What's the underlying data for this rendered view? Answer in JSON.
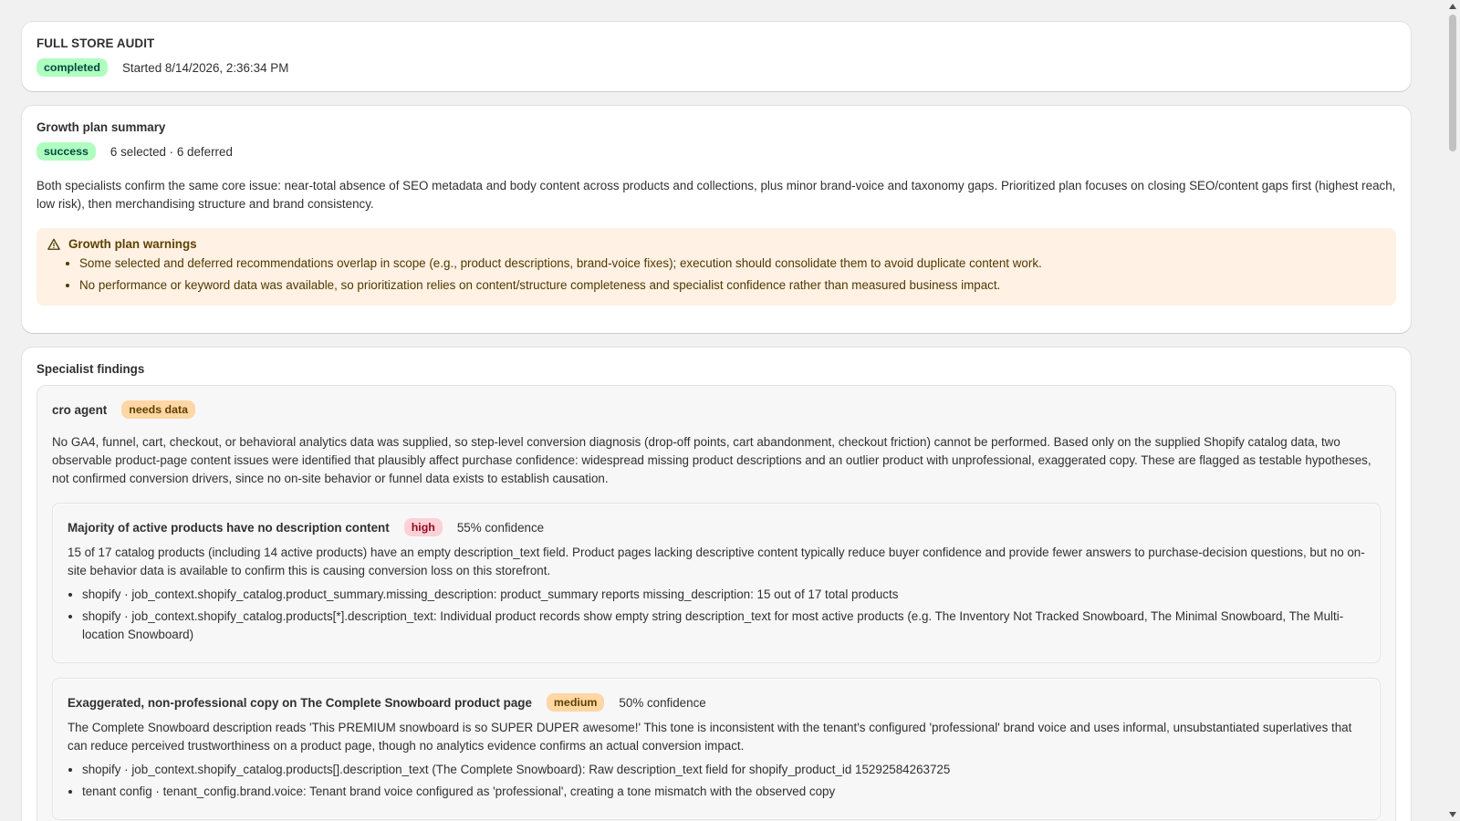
{
  "audit": {
    "title": "FULL STORE AUDIT",
    "status": "completed",
    "started": "Started 8/14/2026, 2:36:34 PM"
  },
  "growth_plan": {
    "title": "Growth plan summary",
    "status": "success",
    "counts": "6 selected · 6 deferred",
    "summary": "Both specialists confirm the same core issue: near-total absence of SEO metadata and body content across products and collections, plus minor brand-voice and taxonomy gaps. Prioritized plan focuses on closing SEO/content gaps first (highest reach, low risk), then merchandising structure and brand consistency.",
    "warnings_title": "Growth plan warnings",
    "warnings": [
      "Some selected and deferred recommendations overlap in scope (e.g., product descriptions, brand-voice fixes); execution should consolidate them to avoid duplicate content work.",
      "No performance or keyword data was available, so prioritization relies on content/structure completeness and specialist confidence rather than measured business impact."
    ]
  },
  "specialists": {
    "title": "Specialist findings",
    "agent": {
      "name": "cro agent",
      "status": "needs data",
      "description": "No GA4, funnel, cart, checkout, or behavioral analytics data was supplied, so step-level conversion diagnosis (drop-off points, cart abandonment, checkout friction) cannot be performed. Based only on the supplied Shopify catalog data, two observable product-page content issues were identified that plausibly affect purchase confidence: widespread missing product descriptions and an outlier product with unprofessional, exaggerated copy. These are flagged as testable hypotheses, not confirmed conversion drivers, since no on-site behavior or funnel data exists to establish causation.",
      "findings": [
        {
          "title": "Majority of active products have no description content",
          "severity": "high",
          "confidence": "55% confidence",
          "body": "15 of 17 catalog products (including 14 active products) have an empty description_text field. Product pages lacking descriptive content typically reduce buyer confidence and provide fewer answers to purchase-decision questions, but no on-site behavior data is available to confirm this is causing conversion loss on this storefront.",
          "evidence": [
            "shopify · job_context.shopify_catalog.product_summary.missing_description: product_summary reports missing_description: 15 out of 17 total products",
            "shopify · job_context.shopify_catalog.products[*].description_text: Individual product records show empty string description_text for most active products (e.g. The Inventory Not Tracked Snowboard, The Minimal Snowboard, The Multi-location Snowboard)"
          ]
        },
        {
          "title": "Exaggerated, non-professional copy on The Complete Snowboard product page",
          "severity": "medium",
          "confidence": "50% confidence",
          "body": "The Complete Snowboard description reads 'This PREMIUM snowboard is so SUPER DUPER awesome!' This tone is inconsistent with the tenant's configured 'professional' brand voice and uses informal, unsubstantiated superlatives that can reduce perceived trustworthiness on a product page, though no analytics evidence confirms an actual conversion impact.",
          "evidence": [
            "shopify · job_context.shopify_catalog.products[].description_text (The Complete Snowboard): Raw description_text field for shopify_product_id 15292584263725",
            "tenant config · tenant_config.brand.voice: Tenant brand voice configured as 'professional', creating a tone mismatch with the observed copy"
          ]
        }
      ]
    }
  }
}
